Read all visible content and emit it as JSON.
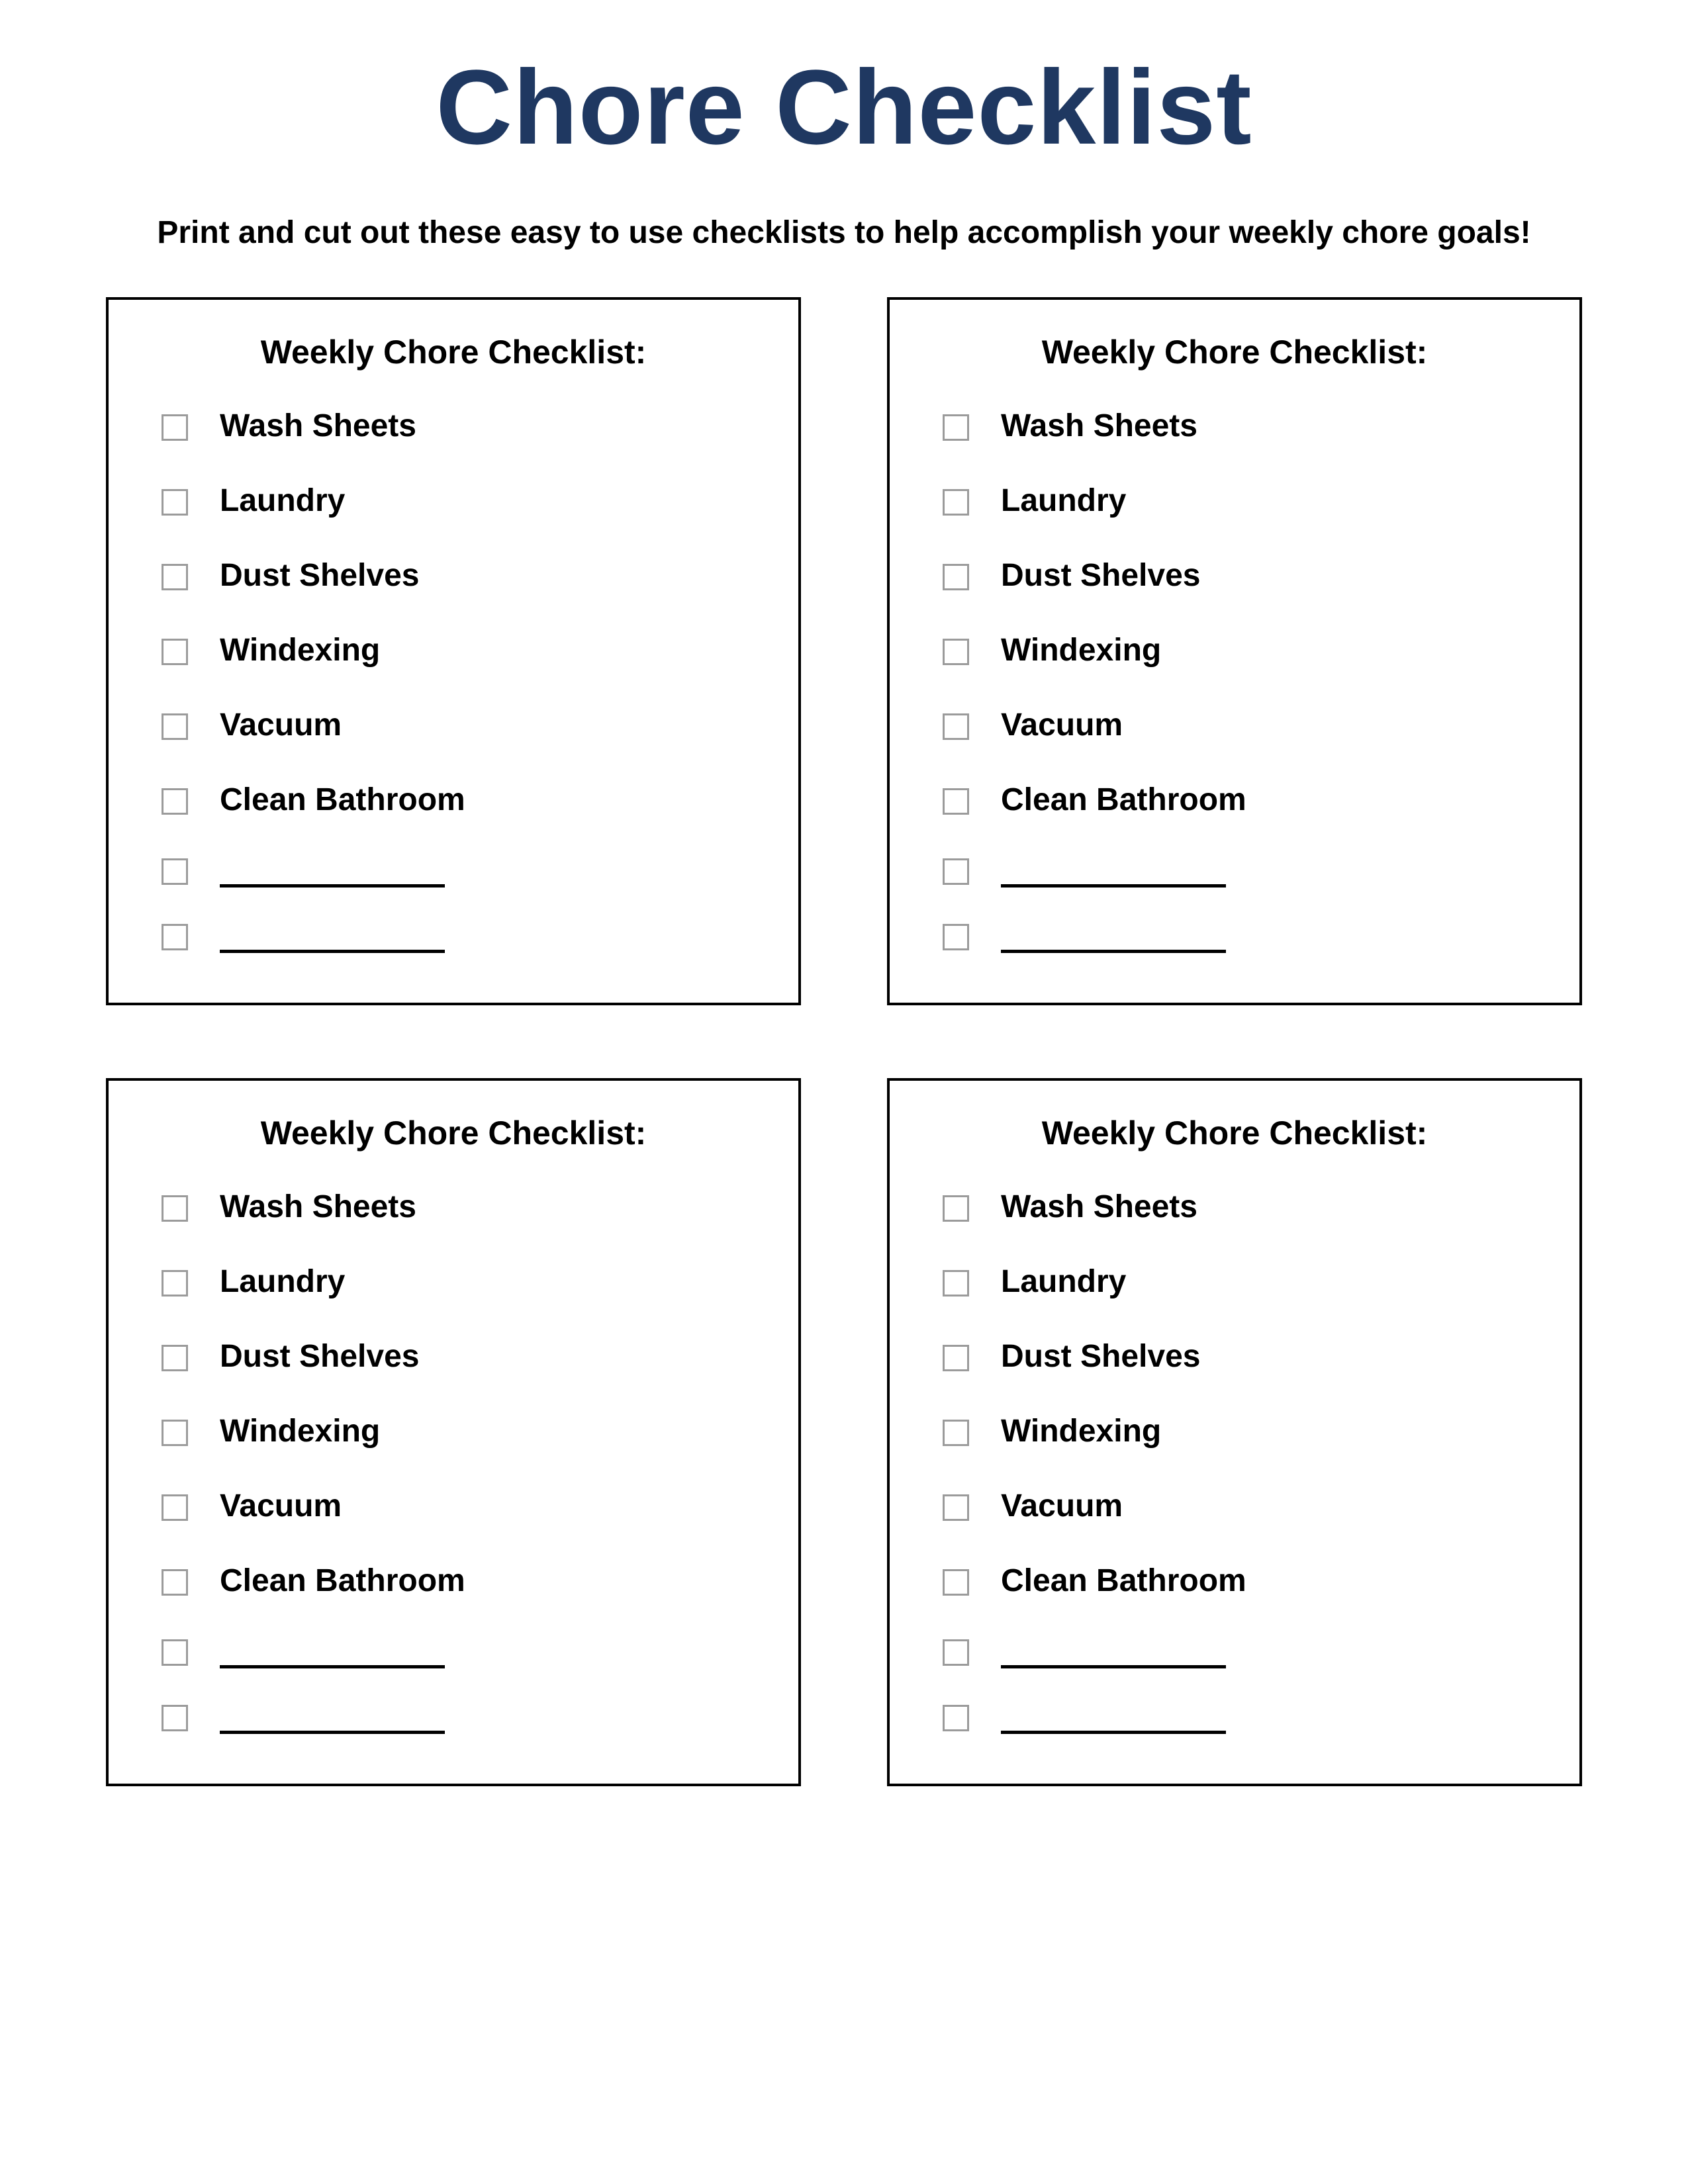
{
  "title": "Chore Checklist",
  "title_color": "#1f3861",
  "subtitle": "Print and cut out these easy to use checklists to help accomplish your weekly chore goals!",
  "card_title": "Weekly Chore Checklist:",
  "cards": [
    {
      "items": [
        {
          "label": "Wash Sheets",
          "blank": false
        },
        {
          "label": "Laundry",
          "blank": false
        },
        {
          "label": "Dust Shelves",
          "blank": false
        },
        {
          "label": "Windexing",
          "blank": false
        },
        {
          "label": "Vacuum",
          "blank": false
        },
        {
          "label": "Clean Bathroom",
          "blank": false
        },
        {
          "label": "",
          "blank": true
        },
        {
          "label": "",
          "blank": true
        }
      ]
    },
    {
      "items": [
        {
          "label": "Wash Sheets",
          "blank": false
        },
        {
          "label": "Laundry",
          "blank": false
        },
        {
          "label": "Dust Shelves",
          "blank": false
        },
        {
          "label": "Windexing",
          "blank": false
        },
        {
          "label": "Vacuum",
          "blank": false
        },
        {
          "label": "Clean Bathroom",
          "blank": false
        },
        {
          "label": "",
          "blank": true
        },
        {
          "label": "",
          "blank": true
        }
      ]
    },
    {
      "items": [
        {
          "label": "Wash Sheets",
          "blank": false
        },
        {
          "label": "Laundry",
          "blank": false
        },
        {
          "label": "Dust Shelves",
          "blank": false
        },
        {
          "label": "Windexing",
          "blank": false
        },
        {
          "label": "Vacuum",
          "blank": false
        },
        {
          "label": "Clean Bathroom",
          "blank": false
        },
        {
          "label": "",
          "blank": true
        },
        {
          "label": "",
          "blank": true
        }
      ]
    },
    {
      "items": [
        {
          "label": "Wash Sheets",
          "blank": false
        },
        {
          "label": "Laundry",
          "blank": false
        },
        {
          "label": "Dust Shelves",
          "blank": false
        },
        {
          "label": "Windexing",
          "blank": false
        },
        {
          "label": "Vacuum",
          "blank": false
        },
        {
          "label": "Clean Bathroom",
          "blank": false
        },
        {
          "label": "",
          "blank": true
        },
        {
          "label": "",
          "blank": true
        }
      ]
    }
  ]
}
